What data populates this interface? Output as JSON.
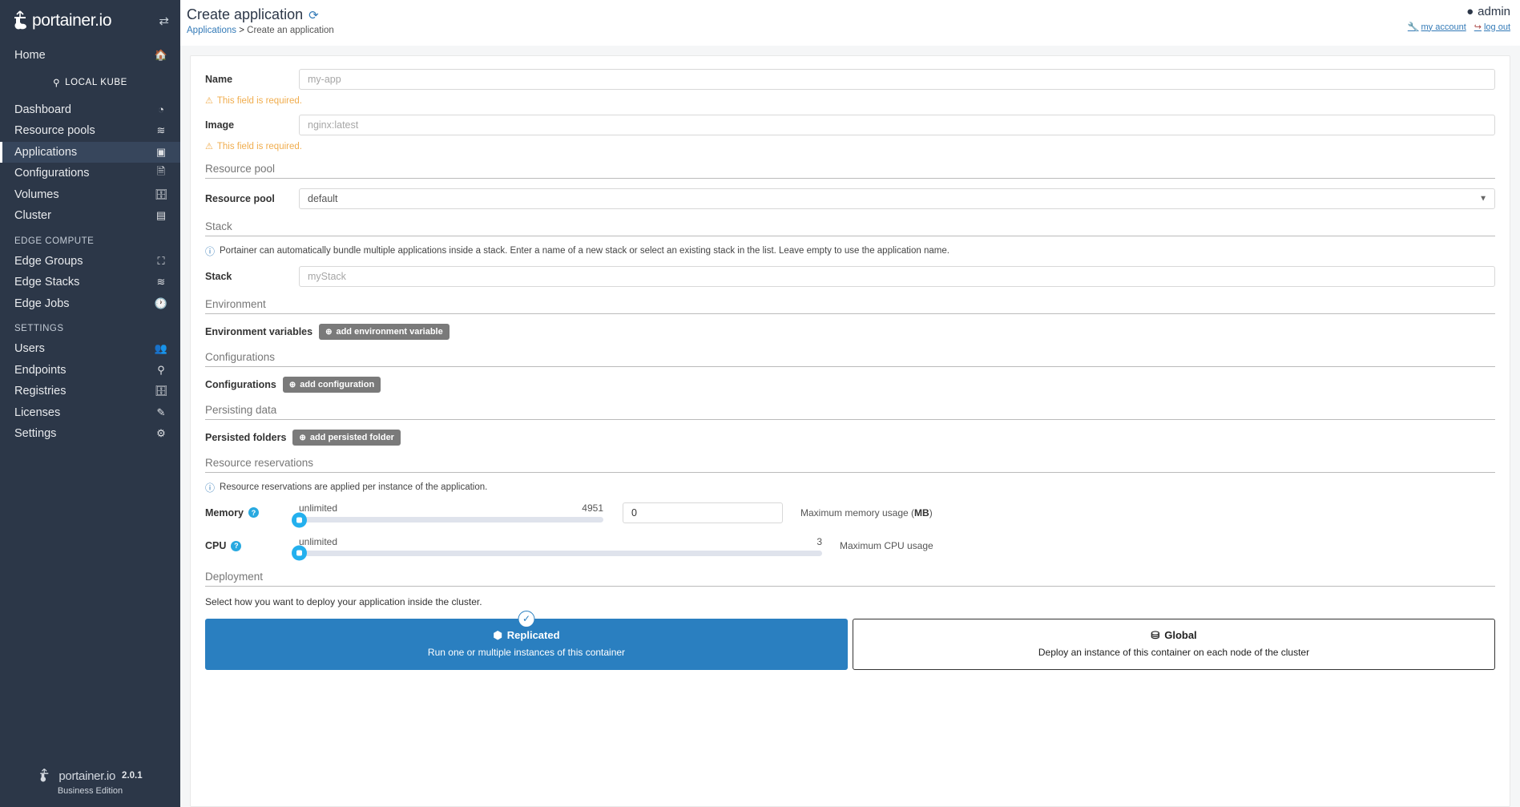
{
  "sidebar": {
    "brand": "portainer.io",
    "collapse_icon": "collapse-arrows-icon",
    "home": {
      "label": "Home",
      "icon": "home-icon"
    },
    "environment": {
      "label": "LOCAL KUBE",
      "icon": "plug-icon"
    },
    "primary_items": [
      {
        "label": "Dashboard",
        "icon": "dashboard-icon",
        "active": false
      },
      {
        "label": "Resource pools",
        "icon": "layers-icon",
        "active": false
      },
      {
        "label": "Applications",
        "icon": "laptop-code-icon",
        "active": true
      },
      {
        "label": "Configurations",
        "icon": "file-code-icon",
        "active": false
      },
      {
        "label": "Volumes",
        "icon": "database-icon",
        "active": false
      },
      {
        "label": "Cluster",
        "icon": "server-icon",
        "active": false
      }
    ],
    "edge_heading": "EDGE COMPUTE",
    "edge_items": [
      {
        "label": "Edge Groups",
        "icon": "edge-group-icon"
      },
      {
        "label": "Edge Stacks",
        "icon": "layers-icon"
      },
      {
        "label": "Edge Jobs",
        "icon": "clock-icon"
      }
    ],
    "settings_heading": "SETTINGS",
    "settings_items": [
      {
        "label": "Users",
        "icon": "users-icon"
      },
      {
        "label": "Endpoints",
        "icon": "plug-icon"
      },
      {
        "label": "Registries",
        "icon": "database-icon"
      },
      {
        "label": "Licenses",
        "icon": "license-icon"
      },
      {
        "label": "Settings",
        "icon": "gears-icon"
      }
    ],
    "footer": {
      "brand": "portainer.io",
      "version": "2.0.1",
      "edition": "Business Edition"
    }
  },
  "header": {
    "title": "Create application",
    "refresh_icon": "refresh-icon",
    "breadcrumb_root": "Applications",
    "breadcrumb_sep": ">",
    "breadcrumb_current": "Create an application",
    "user": "admin",
    "user_icon": "user-circle-icon",
    "my_account": "my account",
    "my_account_icon": "wrench-icon",
    "log_out": "log out",
    "log_out_icon": "sign-out-icon"
  },
  "form": {
    "name": {
      "label": "Name",
      "placeholder": "my-app",
      "value": "",
      "error": "This field is required."
    },
    "image": {
      "label": "Image",
      "placeholder": "nginx:latest",
      "value": "",
      "error": "This field is required."
    },
    "resource_pool": {
      "section": "Resource pool",
      "label": "Resource pool",
      "selected": "default",
      "options": [
        "default"
      ]
    },
    "stack": {
      "section": "Stack",
      "note": "Portainer can automatically bundle multiple applications inside a stack. Enter a name of a new stack or select an existing stack in the list. Leave empty to use the application name.",
      "label": "Stack",
      "placeholder": "myStack",
      "value": ""
    },
    "environment": {
      "section": "Environment",
      "label": "Environment variables",
      "add_button": "add environment variable"
    },
    "configurations": {
      "section": "Configurations",
      "label": "Configurations",
      "add_button": "add configuration"
    },
    "persisting": {
      "section": "Persisting data",
      "label": "Persisted folders",
      "add_button": "add persisted folder"
    },
    "reservations": {
      "section": "Resource reservations",
      "note": "Resource reservations are applied per instance of the application.",
      "memory": {
        "label": "Memory",
        "help_icon": "question-mark-icon",
        "min_label": "unlimited",
        "max_label": "4951",
        "slider_value": 0,
        "input_value": "0",
        "usage_text": "Maximum memory usage (",
        "usage_unit": "MB",
        "usage_text_end": ")"
      },
      "cpu": {
        "label": "CPU",
        "help_icon": "question-mark-icon",
        "min_label": "unlimited",
        "max_label": "3",
        "slider_value": 0,
        "usage_text": "Maximum CPU usage"
      }
    },
    "deployment": {
      "section": "Deployment",
      "note": "Select how you want to deploy your application inside the cluster.",
      "replicated": {
        "title": "Replicated",
        "icon": "cube-icon",
        "subtitle": "Run one or multiple instances of this container",
        "selected": true,
        "check_icon": "check-icon"
      },
      "global": {
        "title": "Global",
        "icon": "cubes-icon",
        "subtitle": "Deploy an instance of this container on each node of the cluster",
        "selected": false
      }
    }
  },
  "colors": {
    "sidebar_bg": "#2c3748",
    "accent_blue": "#337ab7",
    "selected_card": "#2a7fc0",
    "slider_handle": "#23b0ee",
    "warning": "#f0ad4e"
  }
}
